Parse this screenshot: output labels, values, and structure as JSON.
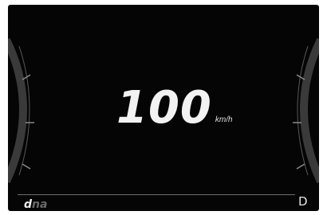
{
  "speedometer": {
    "value": "100",
    "unit": "km/h"
  },
  "drive_mode": {
    "logo_primary": "d",
    "logo_secondary": "na"
  },
  "gear": {
    "indicator": "D"
  },
  "colors": {
    "background": "#050505",
    "primary_text": "#f2f2f2",
    "dim_text": "#6a6a6a",
    "baseline": "#6d6d6d"
  }
}
